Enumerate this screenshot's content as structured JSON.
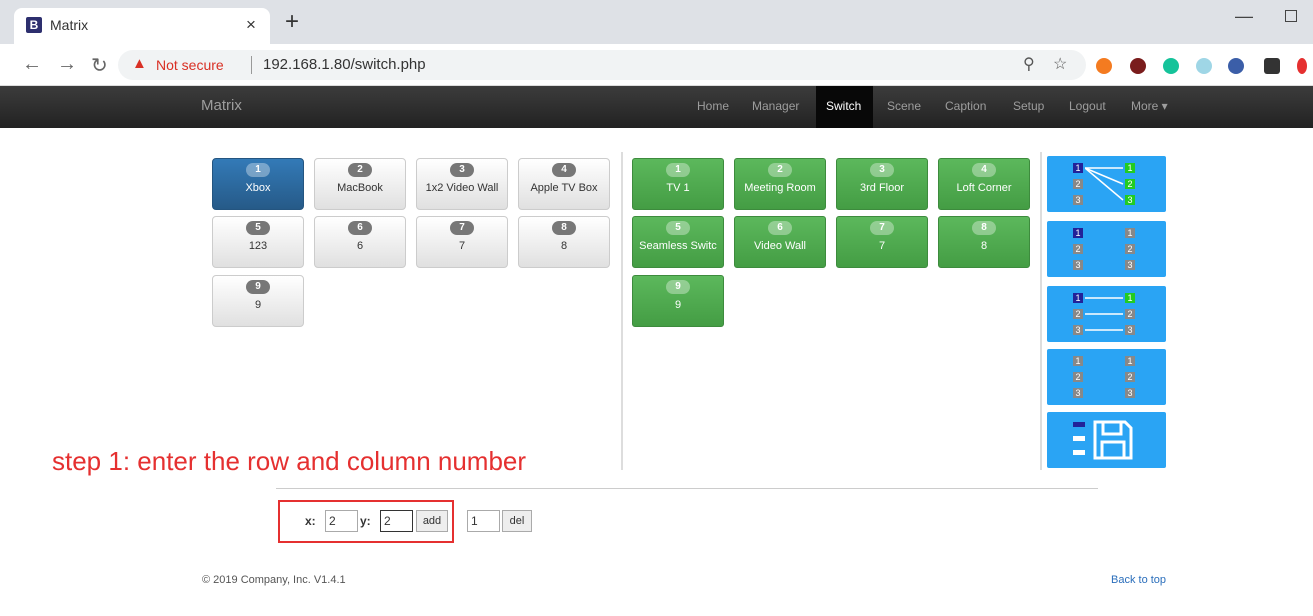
{
  "browser": {
    "tab_title": "Matrix",
    "favicon": "B",
    "close": "×",
    "new_tab": "+",
    "minimize": "—",
    "not_secure": "Not secure",
    "url": "192.168.1.80/switch.php"
  },
  "site": {
    "brand": "Matrix",
    "nav": [
      "Home",
      "Manager",
      "Switch",
      "Scene",
      "Caption",
      "Setup",
      "Logout",
      "More ▾"
    ],
    "active_nav": "Switch"
  },
  "sources": [
    {
      "num": "1",
      "label": "Xbox",
      "active": true
    },
    {
      "num": "2",
      "label": "MacBook"
    },
    {
      "num": "3",
      "label": "1x2 Video Wall"
    },
    {
      "num": "4",
      "label": "Apple TV Box"
    },
    {
      "num": "5",
      "label": "123"
    },
    {
      "num": "6",
      "label": "6"
    },
    {
      "num": "7",
      "label": "7"
    },
    {
      "num": "8",
      "label": "8"
    },
    {
      "num": "9",
      "label": "9"
    }
  ],
  "destinations": [
    {
      "num": "1",
      "label": "TV 1"
    },
    {
      "num": "2",
      "label": "Meeting Room"
    },
    {
      "num": "3",
      "label": "3rd Floor"
    },
    {
      "num": "4",
      "label": "Loft Corner"
    },
    {
      "num": "5",
      "label": "Seamless Switc"
    },
    {
      "num": "6",
      "label": "Video Wall"
    },
    {
      "num": "7",
      "label": "7"
    },
    {
      "num": "8",
      "label": "8"
    },
    {
      "num": "9",
      "label": "9"
    }
  ],
  "presets": {
    "numbers": [
      "1",
      "2",
      "3"
    ]
  },
  "annotation": "step 1: enter the row and column number",
  "form": {
    "x_label": "x:",
    "x_value": "2",
    "y_label": "y:",
    "y_value": "2",
    "add_label": "add",
    "del_value": "1",
    "del_label": "del"
  },
  "footer": {
    "copyright": "© 2019 Company, Inc. V1.4.1",
    "back_to_top": "Back to top"
  },
  "colors": {
    "source_active": "#337ab7",
    "destination": "#5cb85c",
    "preset": "#2aa4f4",
    "annotation": "#e53030"
  }
}
